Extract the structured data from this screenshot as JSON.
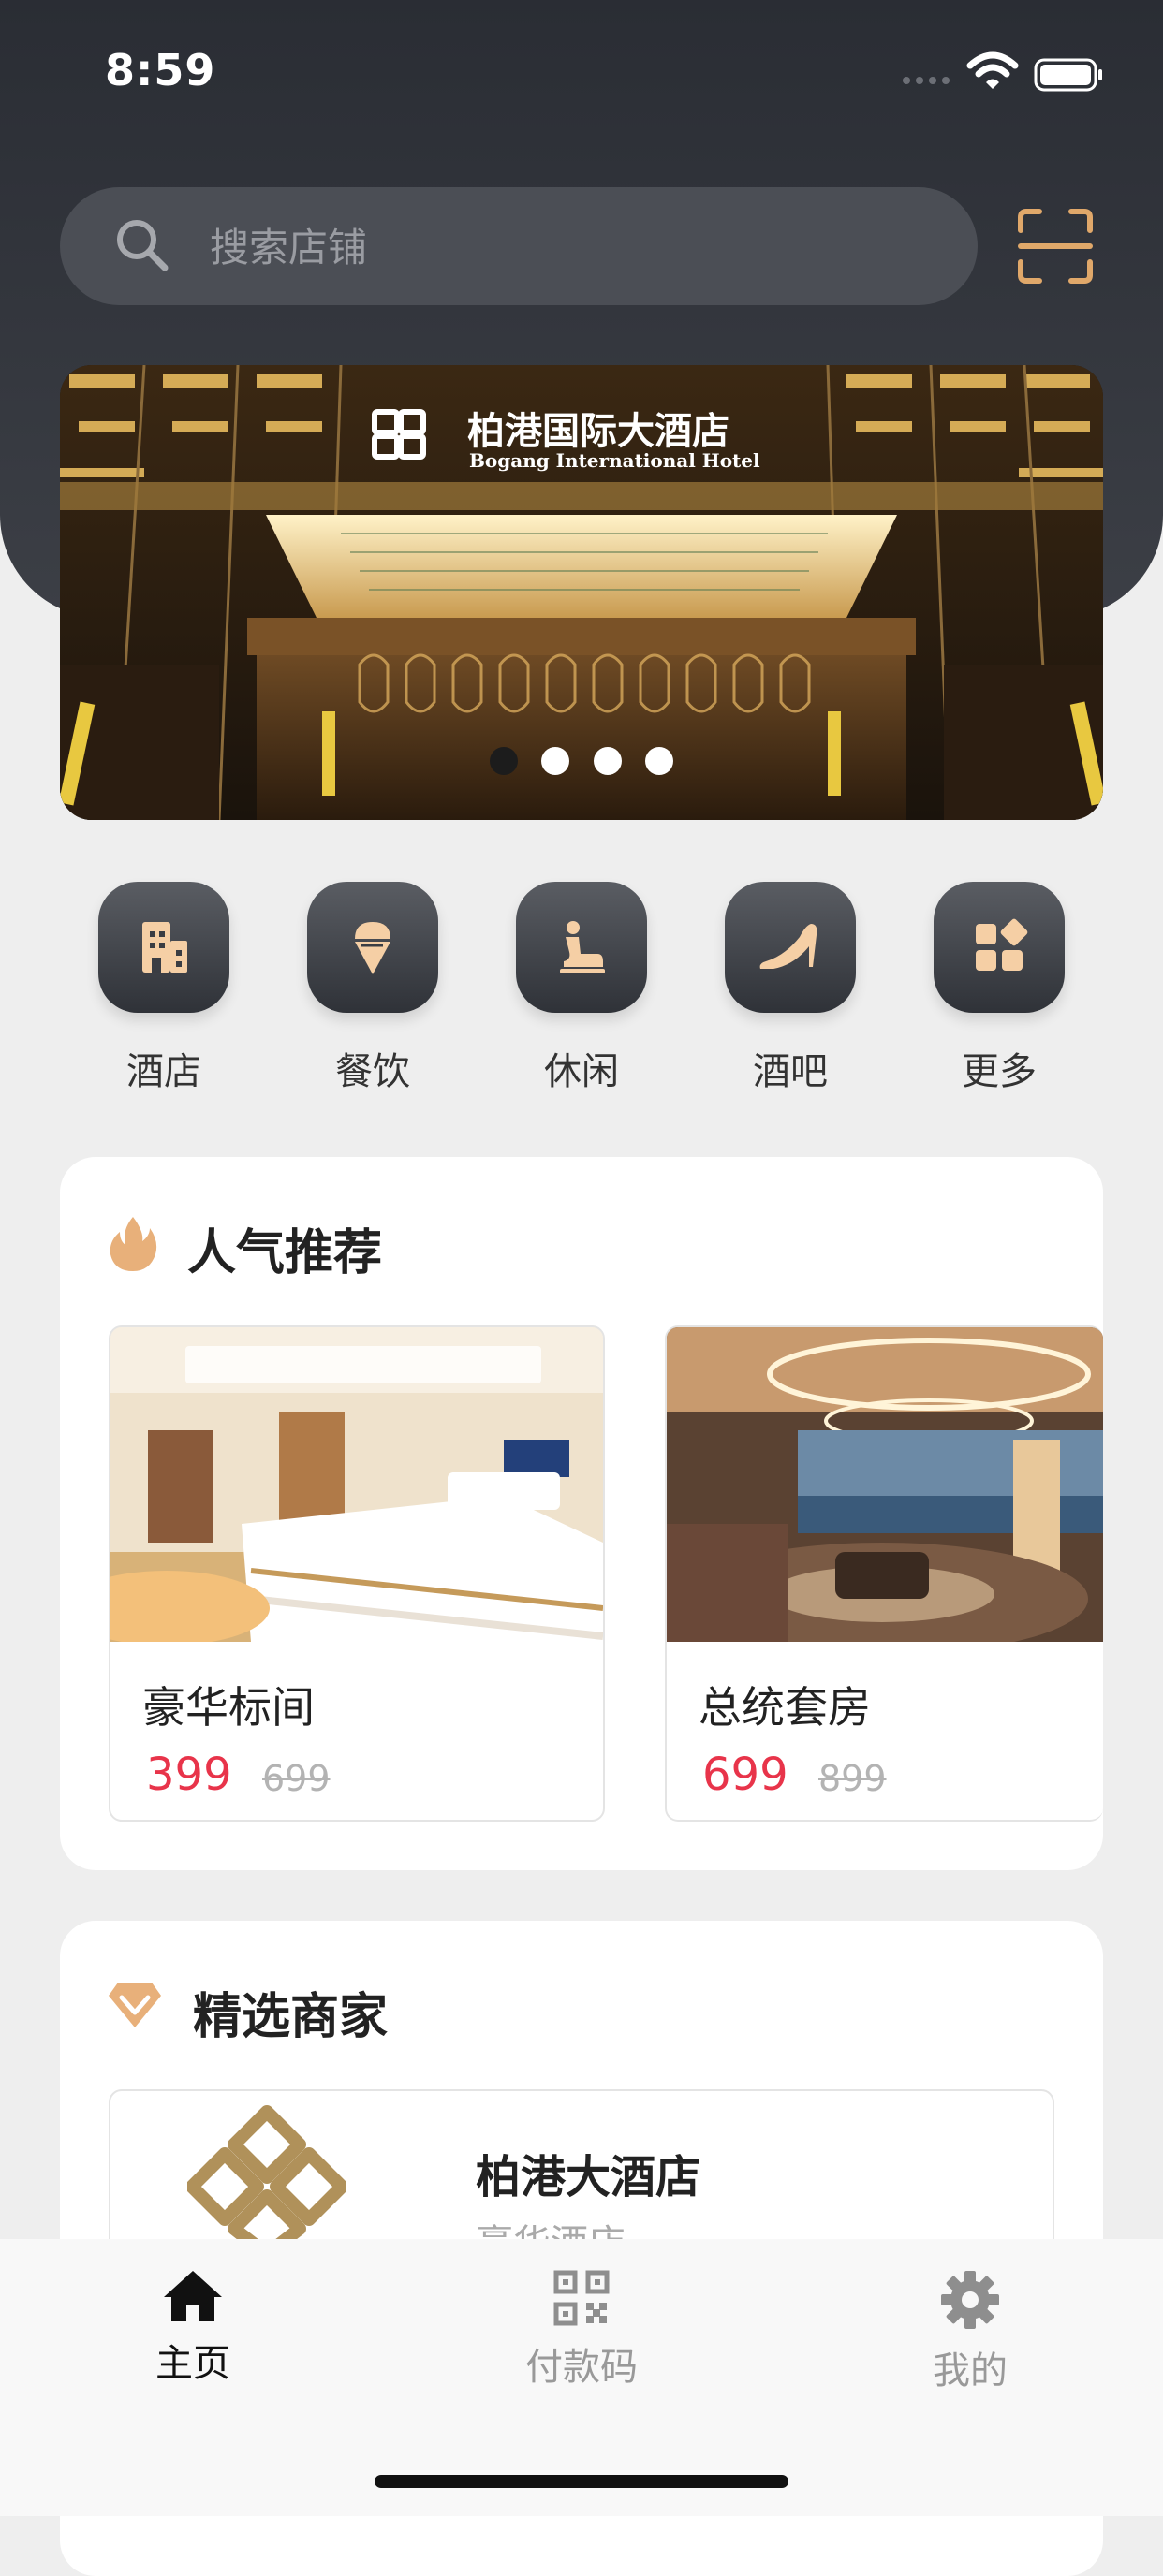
{
  "status_bar": {
    "time": "8:59"
  },
  "search": {
    "placeholder": "搜索店铺"
  },
  "banner": {
    "hotel_name": "柏港国际大酒店",
    "hotel_name_en": "Bogang International Hotel",
    "slide_count": 4,
    "active_slide": 1
  },
  "categories": [
    {
      "label": "酒店",
      "icon": "hotel-icon"
    },
    {
      "label": "餐饮",
      "icon": "ice-cream-icon"
    },
    {
      "label": "休闲",
      "icon": "leisure-icon"
    },
    {
      "label": "酒吧",
      "icon": "high-heel-icon"
    },
    {
      "label": "更多",
      "icon": "more-grid-icon"
    }
  ],
  "popular": {
    "title": "人气推荐",
    "icon": "flame-icon",
    "items": [
      {
        "name": "豪华标间",
        "price": "399",
        "original_price": "699"
      },
      {
        "name": "总统套房",
        "price": "699",
        "original_price": "899"
      }
    ]
  },
  "merchants": {
    "title": "精选商家",
    "icon": "diamond-icon",
    "items": [
      {
        "name": "柏港大酒店",
        "type": "豪华酒店"
      }
    ]
  },
  "tabbar": {
    "items": [
      {
        "label": "主页",
        "icon": "home-icon",
        "active": true
      },
      {
        "label": "付款码",
        "icon": "qrcode-icon",
        "active": false
      },
      {
        "label": "我的",
        "icon": "gear-icon",
        "active": false
      }
    ]
  },
  "colors": {
    "header_dark": "#2a2d34",
    "accent_gold": "#e0a86a",
    "price_red": "#e8344a"
  }
}
